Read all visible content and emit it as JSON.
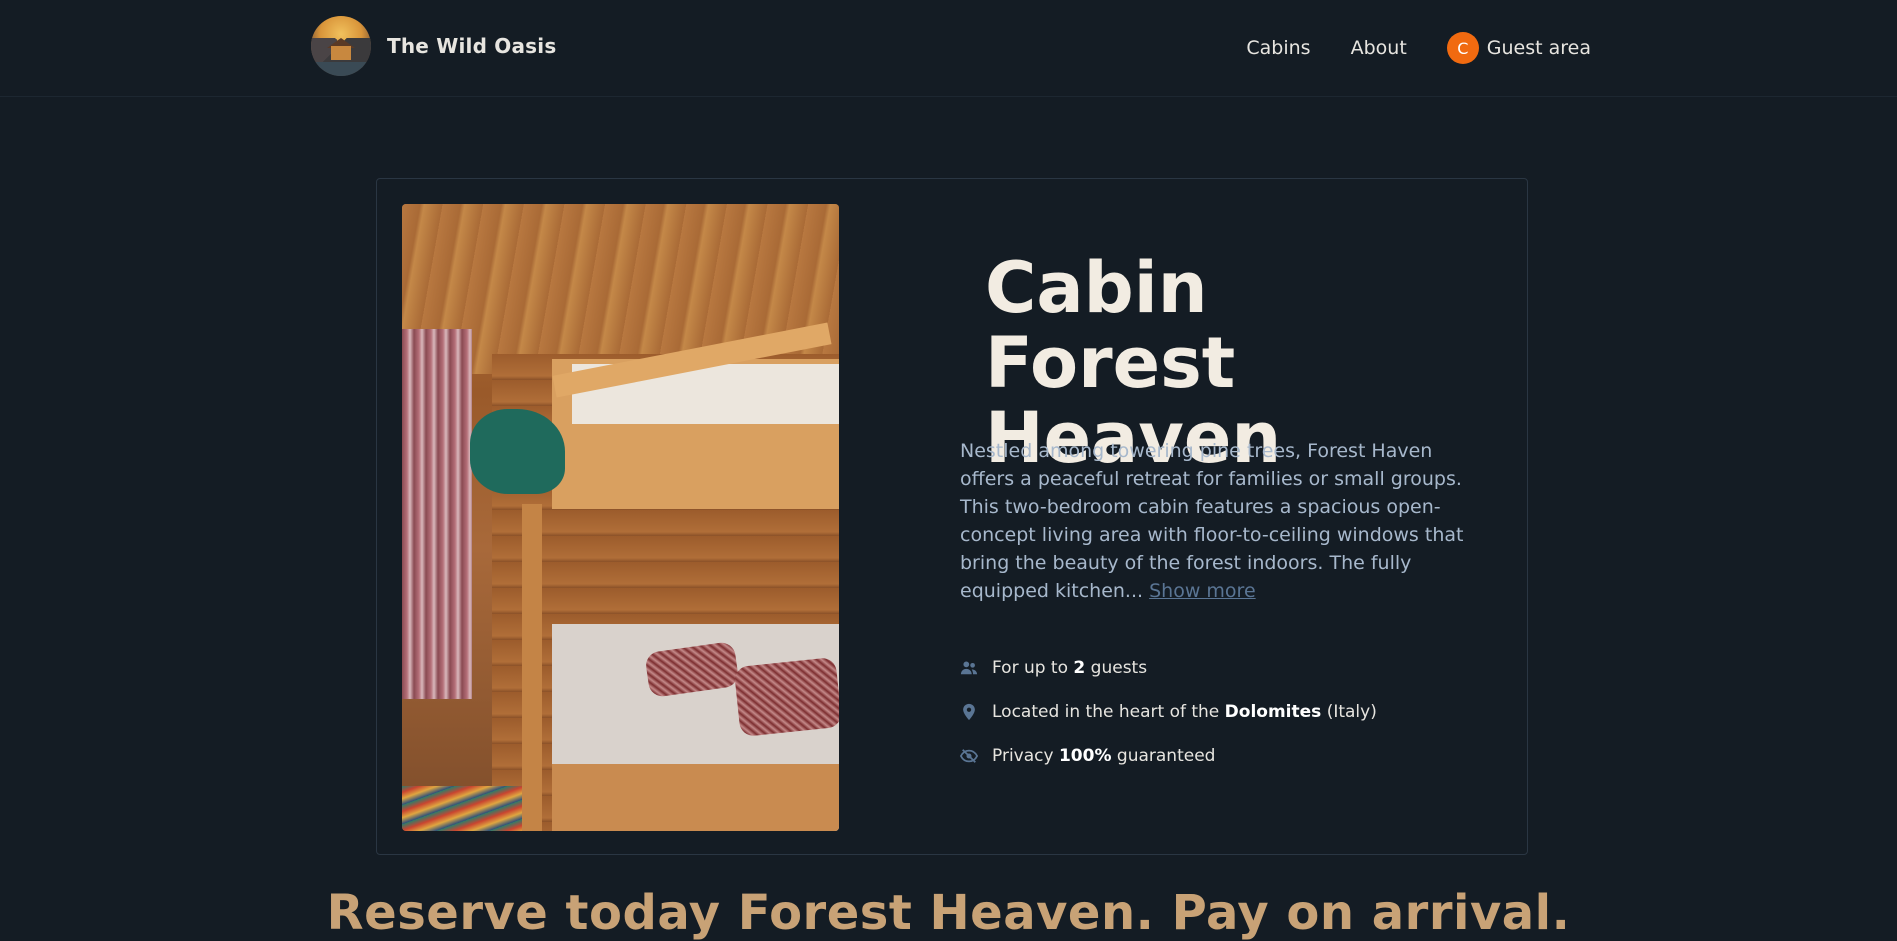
{
  "header": {
    "brand": "The Wild Oasis",
    "nav": {
      "cabins": "Cabins",
      "about": "About",
      "guest_area": "Guest area",
      "avatar_initial": "C"
    }
  },
  "cabin": {
    "title": "Cabin Forest Heaven",
    "description": "Nestled among towering pine trees, Forest Haven offers a peaceful retreat for families or small groups. This two-bedroom cabin features a spacious open-concept living area with floor-to-ceiling windows that bring the beauty of the forest indoors. The fully equipped kitchen...",
    "show_more": "Show more",
    "features": {
      "guests_prefix": "For up to",
      "guests_count": "2",
      "guests_suffix": "guests",
      "location_prefix": "Located in the heart of the",
      "location_place": "Dolomites",
      "location_suffix": "(Italy)",
      "privacy_prefix": "Privacy",
      "privacy_value": "100%",
      "privacy_suffix": "guaranteed"
    },
    "image_icon": "bunk-bed-photo"
  },
  "reserve_heading": "Reserve today Forest Heaven. Pay on arrival.",
  "colors": {
    "background": "#141c24",
    "accent": "#c8a276",
    "avatar": "#f16a10",
    "muted_text": "#a7b8cc"
  }
}
